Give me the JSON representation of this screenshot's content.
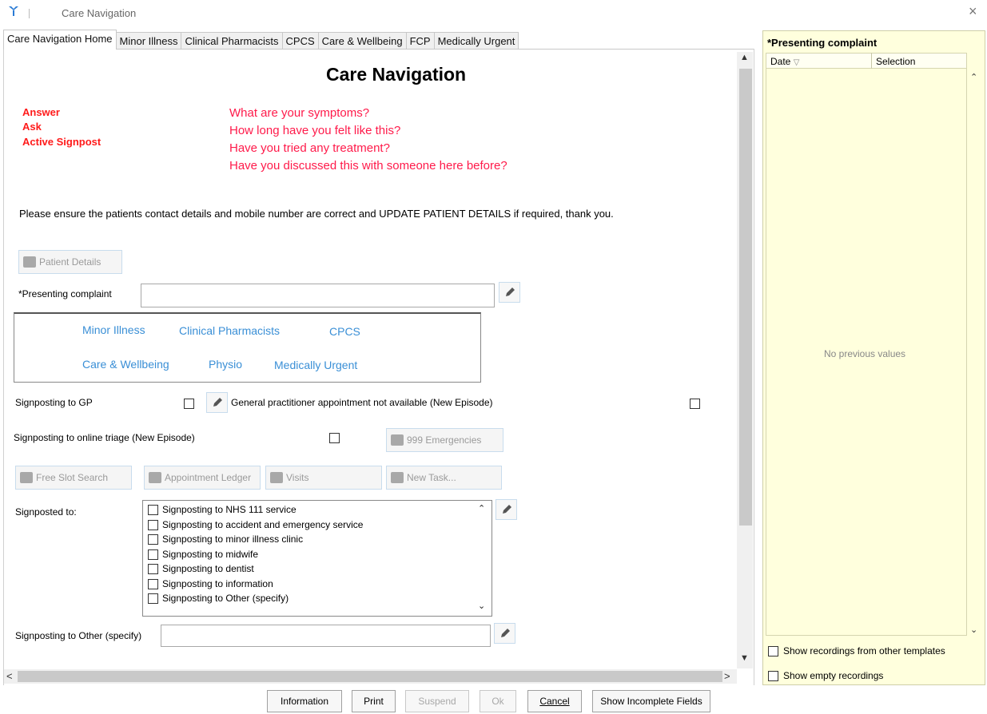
{
  "window": {
    "title": "Care Navigation",
    "close_glyph": "×"
  },
  "tabs": [
    {
      "label": "Care Navigation Home",
      "active": true
    },
    {
      "label": "Minor Illness"
    },
    {
      "label": "Clinical Pharmacists"
    },
    {
      "label": "CPCS"
    },
    {
      "label": "Care & Wellbeing"
    },
    {
      "label": "FCP"
    },
    {
      "label": "Medically Urgent"
    }
  ],
  "main": {
    "heading": "Care Navigation",
    "prompts": [
      "Answer",
      "Ask",
      "Active Signpost"
    ],
    "questions": [
      "What are your symptoms?",
      "How long have you felt like this?",
      "Have you tried any treatment?",
      "Have you discussed this with someone here before?"
    ],
    "notice": "Please ensure the patients contact details and mobile number are correct and UPDATE PATIENT DETAILS if required, thank you.",
    "patient_details_button": "Patient Details",
    "presenting_complaint_label": "*Presenting complaint",
    "presenting_complaint_value": "",
    "pathways": {
      "minor_illness": "Minor Illness",
      "clinical_pharmacists": "Clinical Pharmacists",
      "cpcs": "CPCS",
      "care_wellbeing": "Care & Wellbeing",
      "physio": "Physio",
      "medically_urgent": "Medically Urgent"
    },
    "signposting_gp_label": "Signposting to GP",
    "gp_not_available_label": "General practitioner appointment not available (New Episode)",
    "online_triage_label": "Signposting to online triage (New Episode)",
    "emergencies_button": "999 Emergencies",
    "free_slot_button": "Free Slot Search",
    "appointment_ledger_button": "Appointment Ledger",
    "visits_button": "Visits",
    "new_task_button": "New Task...",
    "signposted_to_label": "Signposted to:",
    "signposted_options": [
      "Signposting to NHS 111 service",
      "Signposting to accident and emergency service",
      "Signposting to minor illness clinic",
      "Signposting to midwife",
      "Signposting to dentist",
      "Signposting to information",
      "Signposting to Other (specify)"
    ],
    "other_specify_label": "Signposting to Other (specify)",
    "other_specify_value": ""
  },
  "footer": {
    "information": "Information",
    "print": "Print",
    "suspend": "Suspend",
    "ok": "Ok",
    "cancel": "Cancel",
    "show_incomplete": "Show Incomplete Fields"
  },
  "right_panel": {
    "title": "*Presenting complaint",
    "col_date": "Date",
    "col_selection": "Selection",
    "empty_text": "No previous values",
    "show_other_templates": "Show recordings from other templates",
    "show_empty": "Show empty recordings"
  },
  "colors": {
    "prompt_red": "#ff1a1a",
    "link_blue": "#3a8fd6",
    "panel_yellow": "#ffffdd"
  }
}
